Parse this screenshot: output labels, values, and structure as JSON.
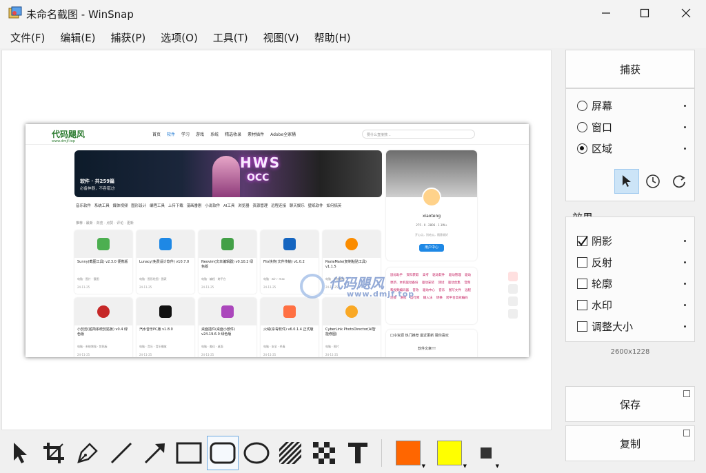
{
  "window": {
    "title": "未命名截图 - WinSnap"
  },
  "menu": [
    "文件(F)",
    "编辑(E)",
    "捕获(P)",
    "选项(O)",
    "工具(T)",
    "视图(V)",
    "帮助(H)"
  ],
  "colors": {
    "primary": "#ff6600",
    "secondary": "#ffff00",
    "accent_blue": "#1976d2"
  },
  "capture": {
    "button_label": "捕获",
    "options": [
      {
        "label": "屏幕",
        "selected": false
      },
      {
        "label": "窗口",
        "selected": false
      },
      {
        "label": "区域",
        "selected": true
      }
    ],
    "modes": [
      "pointer-icon",
      "timer-icon",
      "repeat-icon"
    ],
    "active_mode": "pointer-icon"
  },
  "effects": {
    "label": "效果",
    "items": [
      {
        "label": "阴影",
        "checked": true
      },
      {
        "label": "反射",
        "checked": false
      },
      {
        "label": "轮廓",
        "checked": false
      },
      {
        "label": "水印",
        "checked": false
      },
      {
        "label": "调整大小",
        "checked": false
      }
    ]
  },
  "image_size": "2600x1228",
  "actions": {
    "save": "保存",
    "copy": "复制"
  },
  "toolbar": {
    "tools": [
      "select-tool-icon",
      "crop-tool-icon",
      "pen-tool-icon",
      "line-tool-icon",
      "arrow-tool-icon",
      "rectangle-tool-icon",
      "rounded-rectangle-tool-icon",
      "ellipse-tool-icon",
      "hatch-tool-icon",
      "pixelate-tool-icon",
      "text-tool-icon"
    ],
    "active_tool": "rounded-rectangle-tool-icon"
  },
  "watermark": {
    "main": "代码飓风",
    "sub": "www.dmjf.top"
  },
  "screenshot": {
    "logo": "代码飓风",
    "logo_sub": "www.dmjf.top",
    "nav": [
      "首页",
      "软件",
      "学习",
      "游戏",
      "系统",
      "精选收录",
      "素材插件",
      "Adobe全家桶"
    ],
    "search_placeholder": "要什么直接搜...",
    "banner_title": "软件 · 共259篇",
    "banner_sub": "必备神器，不容错过!",
    "categories": "音乐软件 系统工具 媒体视频 图形设计 编程工具 上传下载 漫画番剧 小说软件 AI工具 浏览器 资源管理 远程连接 聊天娱乐 壁纸软件 如何搞英",
    "sort": "推荐 · 最新 · 浏览 · 点赞 · 评论 · 更新",
    "cards": [
      {
        "name": "Sunny(截图工具) v2.3.0 便携版",
        "tags": "电脑 · 图片 · 截图",
        "date": "24-11-25"
      },
      {
        "name": "Lunacy(免费设计软件) v10.7.0",
        "tags": "电脑 · 图形绘图 · 图表",
        "date": "24-11-25"
      },
      {
        "name": "Neovim(文本编辑器) v0.10.2 绿色版",
        "tags": "电脑 · 编程 · 跨平台",
        "date": "24-11-25"
      },
      {
        "name": "Flix快传(文件传输) v1.0.2",
        "tags": "电脑 · win · mac",
        "date": "24-11-25"
      },
      {
        "name": "PasteMate(复制粘贴工具) v1.1.5",
        "tags": "电脑 · 系统增强",
        "date": "24-11-25"
      },
      {
        "name": "小剪剪(超简系统剪贴板) v0.4 绿色版",
        "tags": "电脑 · 系统增强 · 剪贴板",
        "date": "24-11-25"
      },
      {
        "name": "汽水音乐PC版 v1.8.0",
        "tags": "电脑 · 音乐 · 音乐播放",
        "date": "24-11-25"
      },
      {
        "name": "桌面插件(桌面小部件) v24.19.6.0 绿色版",
        "tags": "电脑 · 美化 · 桌面",
        "date": "24-11-25"
      },
      {
        "name": "火绒(杀毒软件) v6.0.1.4 正式版",
        "tags": "电脑 · 安全 · 杀毒",
        "date": "24-11-25"
      },
      {
        "name": "CyberLink PhotoDirector(AI智能修图)",
        "tags": "电脑 · 图片",
        "date": "24-11-25"
      }
    ],
    "username": "xiaoteng",
    "stats": "275 · 0 · 2806 · 1.1W+",
    "signature": "开心点，别吃瓜，随意就好",
    "user_button": "用户中心",
    "hot_tags": "鼠标助手 资料获取 高考 驱动软件 驱动管理 驱动更新、本机驱动备份 驱动安装 测试 驱动合集 音频和视频编码器 音效 驱动中心 音乐 图写文件 远程连接 进程 运行库 输入法 转换 跨平台高效编码",
    "tabs": "口令资源 热门推荐 最近更新 猜你喜欢",
    "tab_item": "软件文章!!!"
  }
}
